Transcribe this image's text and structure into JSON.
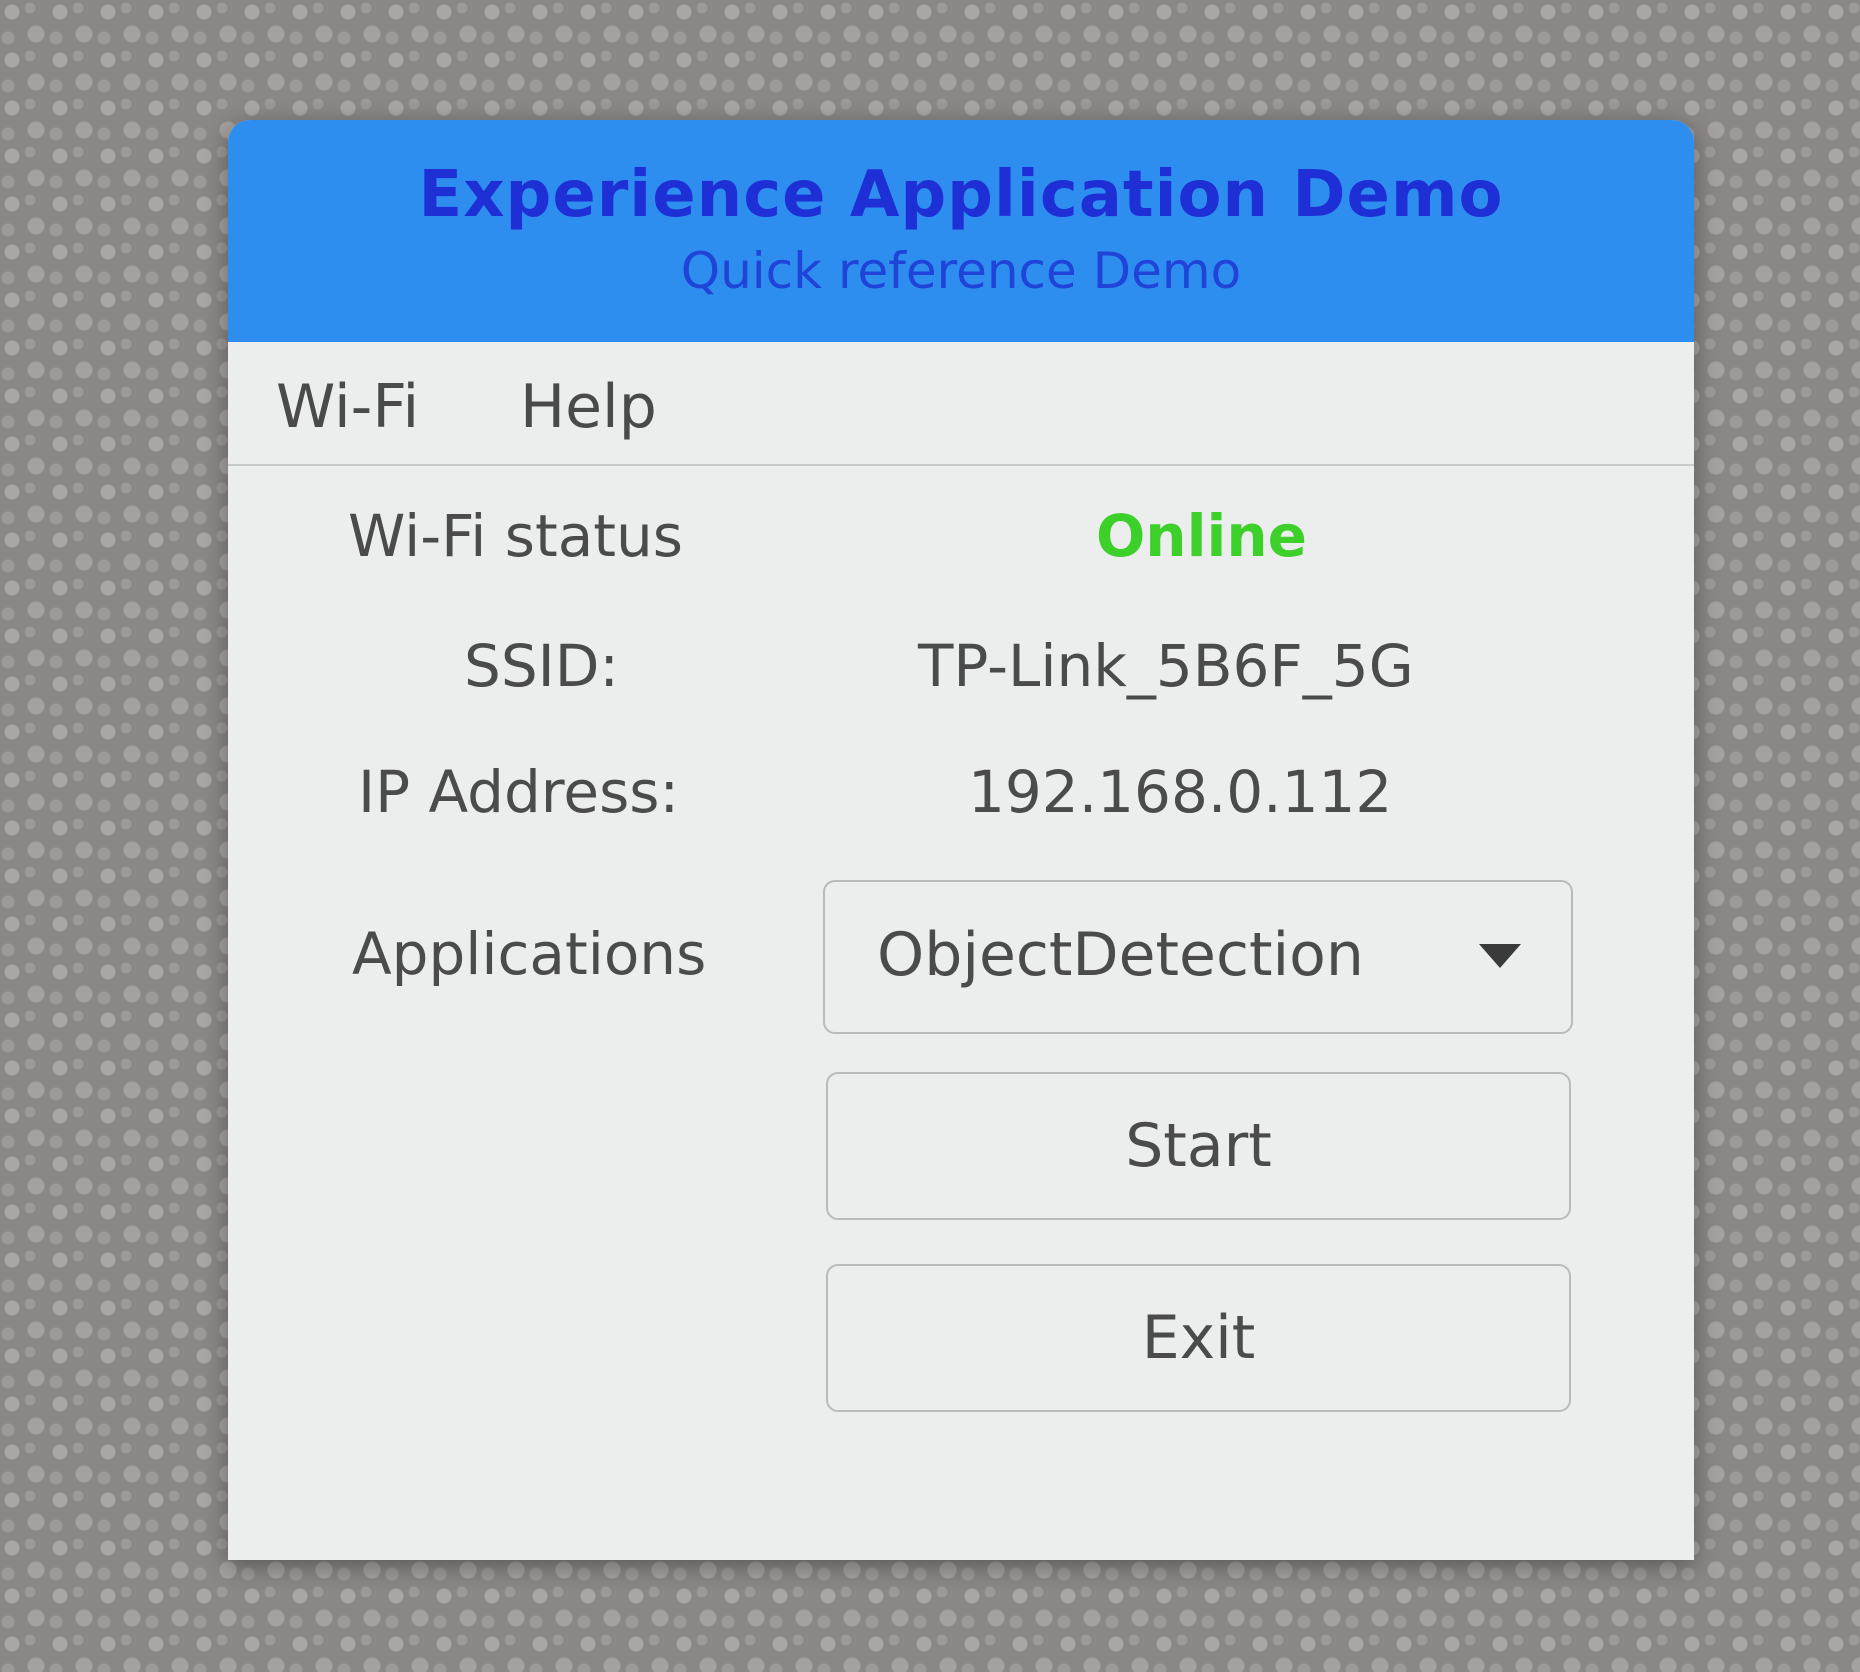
{
  "window": {
    "title": "Experience Application Demo",
    "subtitle": "Quick reference Demo"
  },
  "menu": {
    "items": [
      "Wi-Fi",
      "Help"
    ]
  },
  "info": {
    "wifi_status_label": "Wi-Fi status",
    "wifi_status_value": "Online",
    "ssid_label": "SSID:",
    "ssid_value": "TP-Link_5B6F_5G",
    "ip_label": "IP Address:",
    "ip_value": "192.168.0.112"
  },
  "applications": {
    "label": "Applications",
    "selected": "ObjectDetection"
  },
  "buttons": {
    "start": "Start",
    "exit": "Exit"
  },
  "colors": {
    "titlebar": "#2d8ef0",
    "title_text": "#1f2fd6",
    "status_online": "#3ed02a",
    "window_bg": "#eceeee"
  },
  "icons": {
    "dropdown": "chevron-down-icon"
  }
}
